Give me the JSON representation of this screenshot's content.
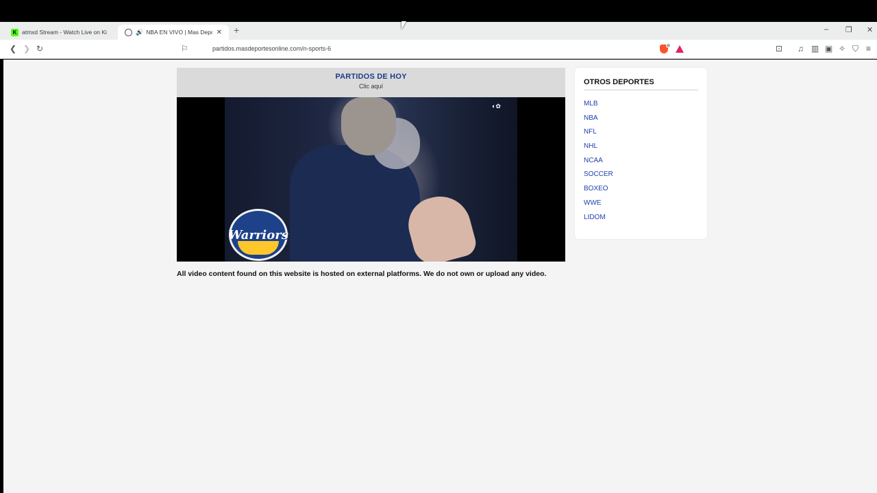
{
  "browser": {
    "tabs": [
      {
        "title": "atmxd Stream - Watch Live on Kick",
        "favicon": "kick-icon",
        "active": false
      },
      {
        "title": "NBA EN VIVO | Mas Deportes",
        "favicon": "globe-icon",
        "active": true,
        "audio": true
      }
    ],
    "new_tab_label": "+",
    "url": "partidos.masdeportesonline.com/n-sports-6",
    "accent": "#fb542b"
  },
  "page": {
    "header": {
      "title": "PARTIDOS DE HOY",
      "link": "Clic aquí"
    },
    "video": {
      "logo_text": "Warriors"
    },
    "disclaimer": "All video content found on this website is hosted on external platforms. We do not own or upload any video.",
    "sidebar": {
      "title": "OTROS DEPORTES",
      "items": [
        "MLB",
        "NBA",
        "NFL",
        "NHL",
        "NCAA",
        "SOCCER",
        "BOXEO",
        "WWE",
        "LIDOM"
      ]
    }
  }
}
